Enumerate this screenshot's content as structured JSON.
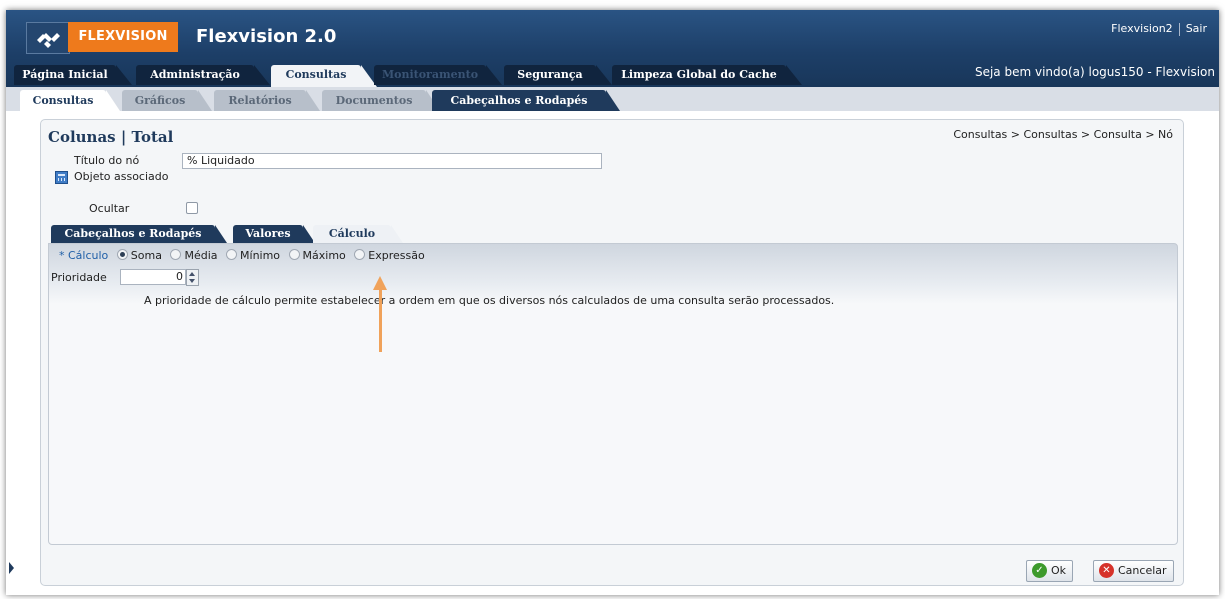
{
  "header": {
    "logo_text": "FLEXVISION",
    "app_title": "Flexvision 2.0",
    "user_link": "Flexvision2",
    "logout_link": "Sair",
    "welcome": "Seja bem vindo(a) logus150 - Flexvision"
  },
  "main_tabs": [
    {
      "label": "Página Inicial"
    },
    {
      "label": "Administração"
    },
    {
      "label": "Consultas"
    },
    {
      "label": "Monitoramento"
    },
    {
      "label": "Segurança"
    },
    {
      "label": "Limpeza Global do Cache"
    }
  ],
  "sub_tabs": [
    {
      "label": "Consultas"
    },
    {
      "label": "Gráficos"
    },
    {
      "label": "Relatórios"
    },
    {
      "label": "Documentos"
    },
    {
      "label": "Cabeçalhos e Rodapés"
    }
  ],
  "panel": {
    "title": "Colunas | Total",
    "breadcrumb": "Consultas > Consultas > Consulta > Nó",
    "node_title_label": "Título do nó",
    "node_title_value": "% Liquidado",
    "associated_object_label": "Objeto associado",
    "hide_label": "Ocultar"
  },
  "inner_tabs": [
    {
      "label": "Cabeçalhos e Rodapés"
    },
    {
      "label": "Valores"
    },
    {
      "label": "Cálculo"
    }
  ],
  "calc": {
    "required_mark": "*",
    "label": "Cálculo",
    "options": [
      {
        "label": "Soma",
        "selected": true
      },
      {
        "label": "Média",
        "selected": false
      },
      {
        "label": "Mínimo",
        "selected": false
      },
      {
        "label": "Máximo",
        "selected": false
      },
      {
        "label": "Expressão",
        "selected": false
      }
    ],
    "priority_label": "Prioridade",
    "priority_value": "0",
    "help_text": "A prioridade de cálculo permite estabelecer a ordem em que os diversos nós calculados de uma consulta serão processados."
  },
  "buttons": {
    "ok": "Ok",
    "cancel": "Cancelar"
  },
  "colors": {
    "brand_orange": "#ee7a1c",
    "header_blue": "#1f3a5c",
    "annotation_arrow": "#f0a25a"
  }
}
